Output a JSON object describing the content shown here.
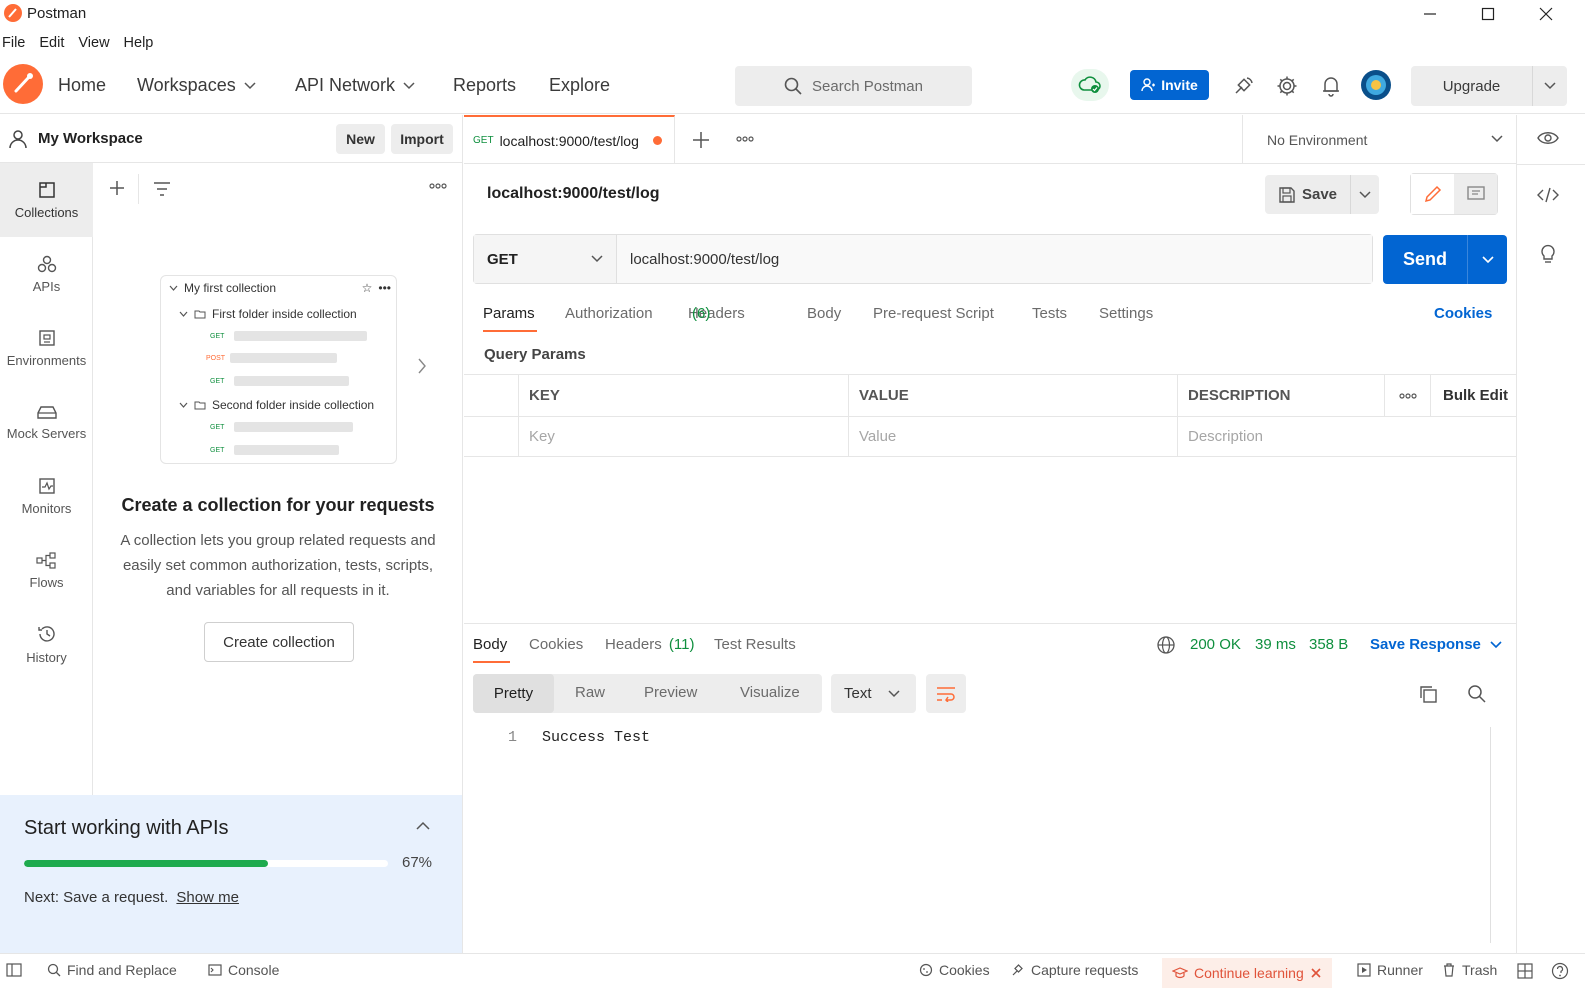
{
  "window": {
    "title": "Postman"
  },
  "menu": [
    "File",
    "Edit",
    "View",
    "Help"
  ],
  "nav": {
    "home": "Home",
    "workspaces": "Workspaces",
    "api_network": "API Network",
    "reports": "Reports",
    "explore": "Explore",
    "search_placeholder": "Search Postman",
    "invite": "Invite",
    "upgrade": "Upgrade"
  },
  "sidebar": {
    "workspace_name": "My Workspace",
    "new_label": "New",
    "import_label": "Import",
    "rail": [
      {
        "label": "Collections",
        "icon": "collections-icon"
      },
      {
        "label": "APIs",
        "icon": "apis-icon"
      },
      {
        "label": "Environments",
        "icon": "environments-icon"
      },
      {
        "label": "Mock Servers",
        "icon": "mock-servers-icon"
      },
      {
        "label": "Monitors",
        "icon": "monitors-icon"
      },
      {
        "label": "Flows",
        "icon": "flows-icon"
      },
      {
        "label": "History",
        "icon": "history-icon"
      }
    ],
    "illustration": {
      "collection": "My first collection",
      "folder1": "First folder inside collection",
      "folder2": "Second folder inside collection",
      "methods1": [
        "GET",
        "POST",
        "GET"
      ],
      "methods2": [
        "GET",
        "GET"
      ]
    },
    "empty_title": "Create a collection for your requests",
    "empty_desc_1": "A collection lets you group related requests and",
    "empty_desc_2": "easily set common authorization, tests, scripts,",
    "empty_desc_3": "and variables for all requests in it.",
    "create_button": "Create collection",
    "onboarding": {
      "title": "Start working with APIs",
      "progress_percent": 67,
      "progress_label": "67%",
      "next_text": "Next: Save a request.",
      "show_me": "Show me"
    }
  },
  "tab": {
    "method": "GET",
    "title": "localhost:9000/test/log"
  },
  "environment": "No Environment",
  "request": {
    "name": "localhost:9000/test/log",
    "save": "Save",
    "method": "GET",
    "url": "localhost:9000/test/log",
    "send": "Send",
    "tabs": [
      "Params",
      "Authorization",
      "Headers",
      "Body",
      "Pre-request Script",
      "Tests",
      "Settings"
    ],
    "headers_count": "(6)",
    "cookies": "Cookies",
    "query_params_title": "Query Params",
    "columns": {
      "key": "KEY",
      "value": "VALUE",
      "description": "DESCRIPTION",
      "bulk_edit": "Bulk Edit"
    },
    "placeholders": {
      "key": "Key",
      "value": "Value",
      "description": "Description"
    }
  },
  "response": {
    "tabs": [
      "Body",
      "Cookies",
      "Headers",
      "Test Results"
    ],
    "headers_count": "(11)",
    "status": "200 OK",
    "time": "39 ms",
    "size": "358 B",
    "save_response": "Save Response",
    "views": [
      "Pretty",
      "Raw",
      "Preview",
      "Visualize"
    ],
    "format": "Text",
    "lines": [
      {
        "num": "1",
        "text": "Success Test"
      }
    ]
  },
  "statusbar": {
    "find_replace": "Find and Replace",
    "console": "Console",
    "cookies": "Cookies",
    "capture": "Capture requests",
    "continue_learning": "Continue learning",
    "runner": "Runner",
    "trash": "Trash"
  },
  "colors": {
    "accent": "#ff6c37",
    "primary": "#0265d2",
    "success": "#0f8f3e",
    "progress": "#1eaa4e"
  }
}
